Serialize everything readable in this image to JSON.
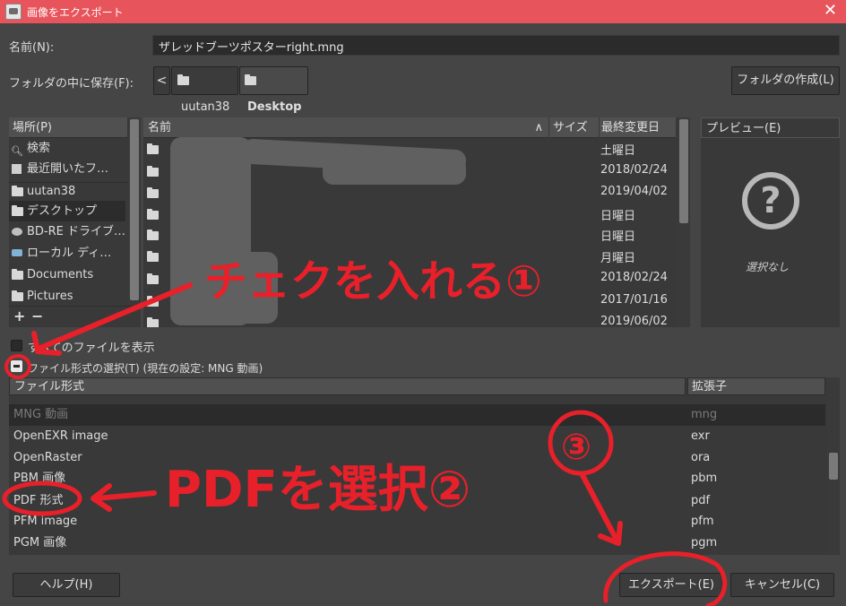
{
  "window": {
    "title": "画像をエクスポート",
    "close_glyph": "✕"
  },
  "name_row": {
    "label": "名前(N):",
    "value": "ザレッドブーツポスターright.mng"
  },
  "save_in": {
    "label": "フォルダの中に保存(F):",
    "back_glyph": "<",
    "crumbs": [
      "uutan38",
      "Desktop"
    ],
    "create_folder_label": "フォルダの作成(L)"
  },
  "places": {
    "header": "場所(P)",
    "items": [
      {
        "label": "検索",
        "icon": "search-icon"
      },
      {
        "label": "最近開いたフ…",
        "icon": "recent-icon"
      },
      {
        "label": "uutan38",
        "icon": "folder-icon"
      },
      {
        "label": "デスクトップ",
        "icon": "folder-icon"
      },
      {
        "label": "BD-RE ドライブ…",
        "icon": "disc-icon"
      },
      {
        "label": "ローカル ディ…",
        "icon": "drive-icon"
      },
      {
        "label": "Documents",
        "icon": "folder-icon"
      },
      {
        "label": "Pictures",
        "icon": "folder-icon"
      }
    ],
    "add_glyph": "+",
    "remove_glyph": "−"
  },
  "files": {
    "col_name": "名前",
    "col_size": "サイズ",
    "col_modified": "最終変更日",
    "sort_glyph": "∧",
    "rows": [
      {
        "date": "土曜日"
      },
      {
        "date": "2018/02/24"
      },
      {
        "date": "2019/04/02"
      },
      {
        "date": "日曜日"
      },
      {
        "date": "日曜日"
      },
      {
        "date": "月曜日"
      },
      {
        "date": "2018/02/24"
      },
      {
        "date": "2017/01/16"
      },
      {
        "date": "2019/06/02"
      }
    ]
  },
  "preview": {
    "header": "プレビュー(E)",
    "glyph": "?",
    "none_text": "選択なし"
  },
  "show_all": {
    "label": "すべてのファイルを表示"
  },
  "filetype_toggle": {
    "label": "ファイル形式の選択(T) (現在の設定: MNG 動画)"
  },
  "formats": {
    "col_type": "ファイル形式",
    "col_ext": "拡張子",
    "rows": [
      {
        "name": "MNG 動画",
        "ext": "mng"
      },
      {
        "name": "OpenEXR image",
        "ext": "exr"
      },
      {
        "name": "OpenRaster",
        "ext": "ora"
      },
      {
        "name": "PBM 画像",
        "ext": "pbm"
      },
      {
        "name": "PDF 形式",
        "ext": "pdf"
      },
      {
        "name": "PFM image",
        "ext": "pfm"
      },
      {
        "name": "PGM 画像",
        "ext": "pgm"
      }
    ]
  },
  "buttons": {
    "help": "ヘルプ(H)",
    "export": "エクスポート(E)",
    "cancel": "キャンセル(C)"
  },
  "annotations": {
    "note1": "チェクを入れる①",
    "note2": "PDFを選択②",
    "note3": "③",
    "color": "#e8202a"
  }
}
